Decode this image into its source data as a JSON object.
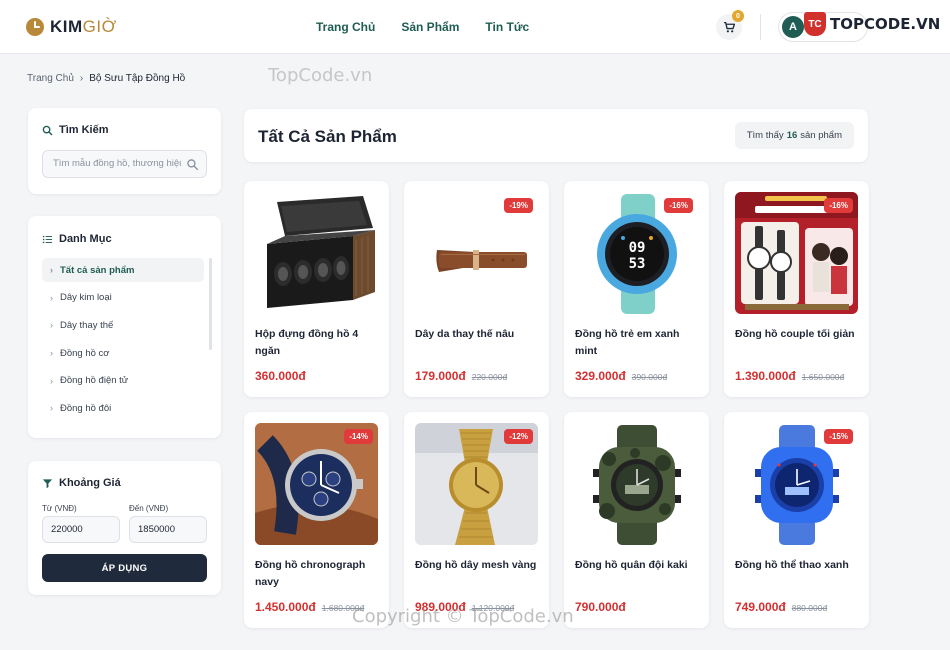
{
  "header": {
    "logo_main": "KIM",
    "logo_accent": "GIỜ",
    "nav": [
      "Trang Chủ",
      "Sản Phẩm",
      "Tin Tức"
    ],
    "cart_count": "0",
    "avatar_initial": "A",
    "topcode_badge": "TC",
    "topcode_text": "TOPCODE.VN"
  },
  "watermarks": {
    "top": "TopCode.vn",
    "bottom": "Copyright © TopCode.vn"
  },
  "breadcrumb": {
    "home": "Trang Chủ",
    "separator": "›",
    "current": "Bộ Sưu Tập Đồng Hồ"
  },
  "search": {
    "title": "Tìm Kiếm",
    "placeholder": "Tìm mẫu đồng hồ, thương hiệu..."
  },
  "categories": {
    "title": "Danh Mục",
    "items": [
      "Tất cả sản phẩm",
      "Dây kim loại",
      "Dây thay thế",
      "Đồng hồ cơ",
      "Đồng hồ điện tử",
      "Đồng hồ đôi"
    ]
  },
  "price_filter": {
    "title": "Khoảng Giá",
    "from_label": "Từ (VNĐ)",
    "to_label": "Đến (VNĐ)",
    "from_value": "220000",
    "to_value": "1850000",
    "apply_label": "ÁP DỤNG"
  },
  "main": {
    "title": "Tất Cả Sản Phẩm",
    "found_prefix": "Tìm thấy",
    "found_count": "16",
    "found_suffix": "sản phẩm"
  },
  "products": [
    {
      "name": "Hộp đựng đồng hồ 4 ngăn",
      "price": "360.000đ",
      "old_price": "",
      "discount": "",
      "image": "watch-box"
    },
    {
      "name": "Dây da thay thế nâu",
      "price": "179.000đ",
      "old_price": "220.000đ",
      "discount": "-19%",
      "image": "leather-strap"
    },
    {
      "name": "Đồng hồ trẻ em xanh mint",
      "price": "329.000đ",
      "old_price": "390.000đ",
      "discount": "-16%",
      "image": "kids-smartwatch"
    },
    {
      "name": "Đồng hồ couple tối giản",
      "price": "1.390.000đ",
      "old_price": "1.650.000đ",
      "discount": "-16%",
      "image": "couple-watch-ad"
    },
    {
      "name": "Đồng hồ chronograph navy",
      "price": "1.450.000đ",
      "old_price": "1.680.000đ",
      "discount": "-14%",
      "image": "navy-chronograph"
    },
    {
      "name": "Đồng hồ dây mesh vàng",
      "price": "989.000đ",
      "old_price": "1.120.000đ",
      "discount": "-12%",
      "image": "gold-mesh-watch"
    },
    {
      "name": "Đồng hồ quân đội kaki",
      "price": "790.000đ",
      "old_price": "",
      "discount": "",
      "image": "camo-sport-watch"
    },
    {
      "name": "Đồng hồ thể thao xanh",
      "price": "749.000đ",
      "old_price": "880.000đ",
      "discount": "-15%",
      "image": "blue-sport-watch"
    }
  ],
  "colors": {
    "brand_gold": "#b8893a",
    "nav_green": "#1f5c53",
    "price_red": "#d62f2f",
    "badge_red": "#e03a3a",
    "button_dark": "#1f2a3c"
  }
}
